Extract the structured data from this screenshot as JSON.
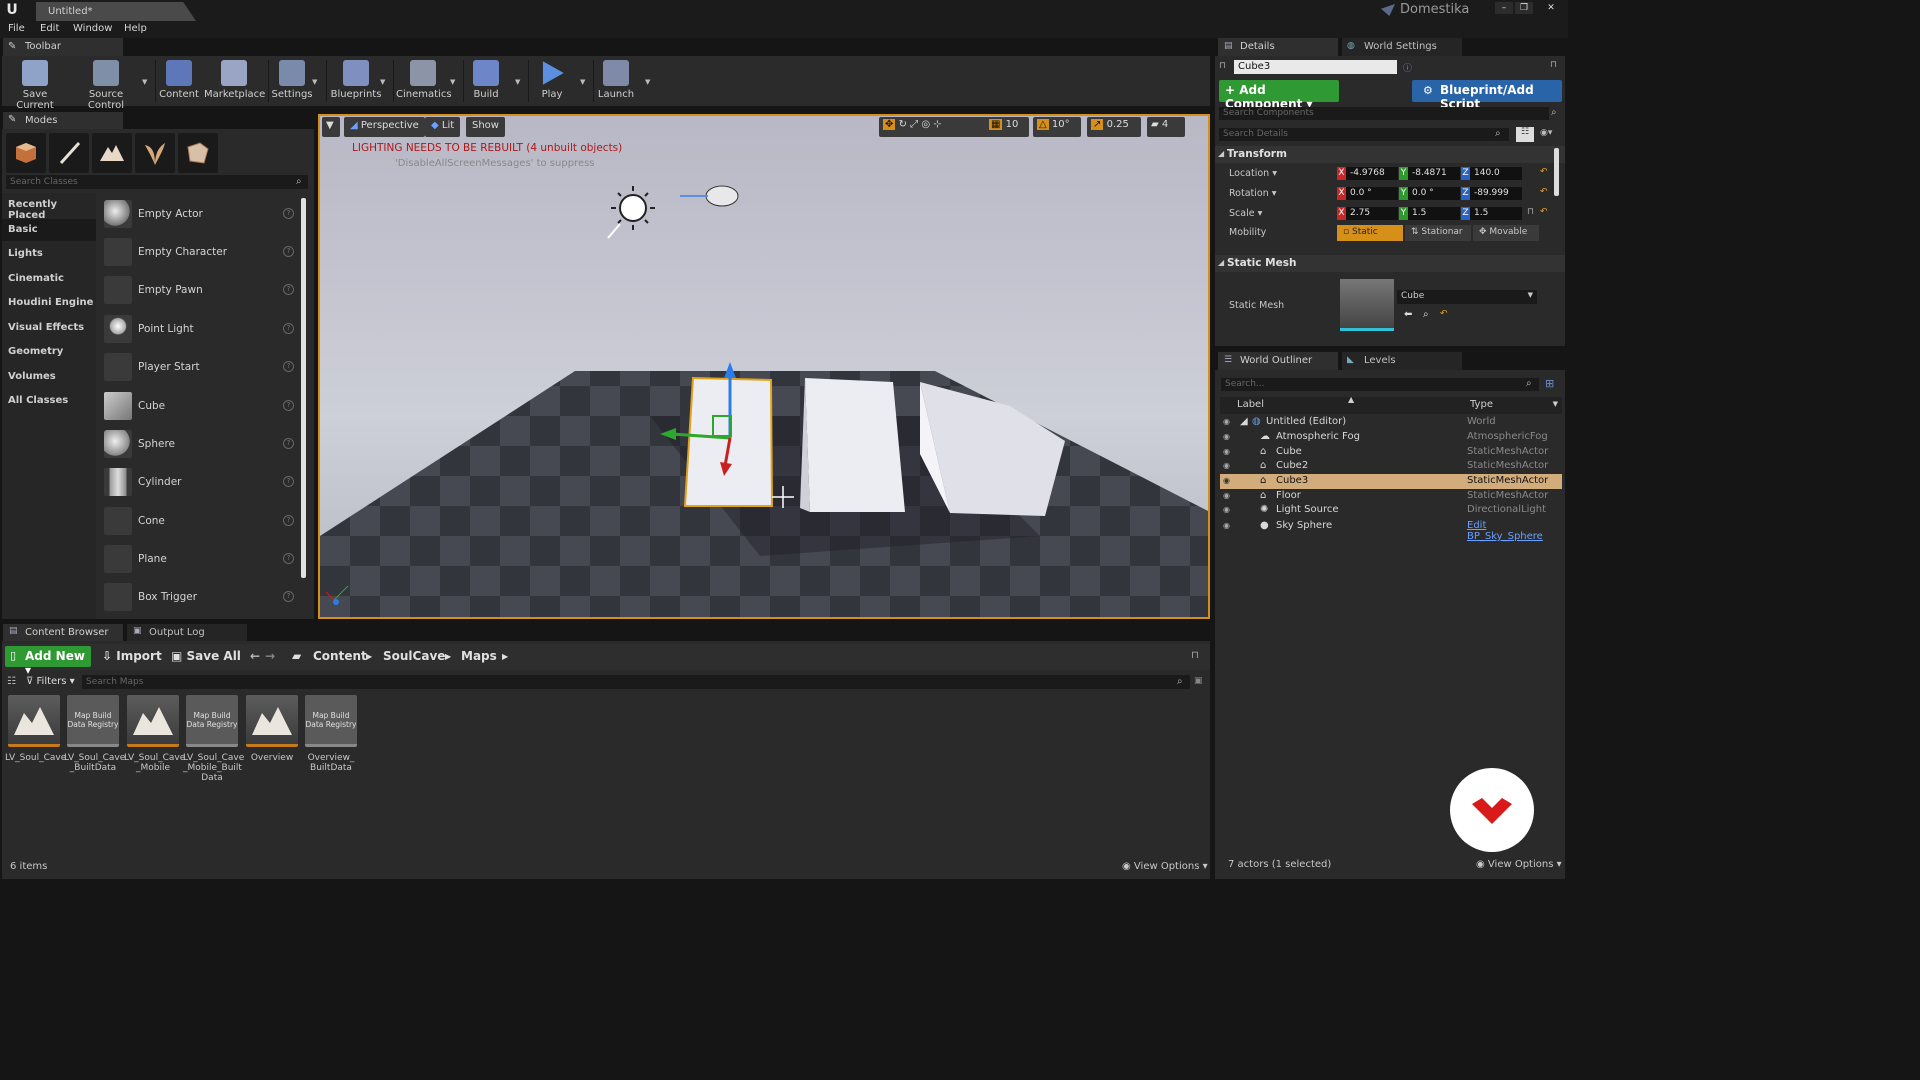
{
  "window": {
    "title": "Untitled*",
    "brand": "Domestika",
    "controls": [
      "–",
      "❐",
      "✕"
    ]
  },
  "menu": [
    "File",
    "Edit",
    "Window",
    "Help"
  ],
  "toolbar": {
    "tab": "Toolbar",
    "buttons": [
      {
        "label": "Save Current",
        "color": "#8fa3c8"
      },
      {
        "label": "Source Control",
        "color": "#7f8fa8"
      },
      {
        "label": "Content",
        "color": "#5d77b8"
      },
      {
        "label": "Marketplace",
        "color": "#9aa4c4"
      },
      {
        "label": "Settings",
        "color": "#7a8aaa"
      },
      {
        "label": "Blueprints",
        "color": "#7f90c0"
      },
      {
        "label": "Cinematics",
        "color": "#8c95a8"
      },
      {
        "label": "Build",
        "color": "#6d86c8"
      },
      {
        "label": "Play",
        "color": "#5d8fe0"
      },
      {
        "label": "Launch",
        "color": "#7e8aa8"
      }
    ]
  },
  "modes": {
    "tab": "Modes",
    "mode_icons": [
      "place-mode-icon",
      "paint-mode-icon",
      "landscape-mode-icon",
      "foliage-mode-icon",
      "geometry-mode-icon"
    ],
    "search_placeholder": "Search Classes",
    "categories": [
      "Recently Placed",
      "Basic",
      "Lights",
      "Cinematic",
      "Houdini Engine",
      "Visual Effects",
      "Geometry",
      "Volumes",
      "All Classes"
    ],
    "selected_category": "Basic",
    "items": [
      "Empty Actor",
      "Empty Character",
      "Empty Pawn",
      "Point Light",
      "Player Start",
      "Cube",
      "Sphere",
      "Cylinder",
      "Cone",
      "Plane",
      "Box Trigger"
    ]
  },
  "viewport": {
    "view_mode": "Perspective",
    "lighting": "Lit",
    "show": "Show",
    "grid_snap": "10",
    "rotation_snap": "10°",
    "scale_snap": "0.25",
    "camera_speed": "4",
    "warning": "LIGHTING NEEDS TO BE REBUILT (4 unbuilt objects)",
    "warning_hint": "'DisableAllScreenMessages' to suppress",
    "selection_color": "#d6901a"
  },
  "content_browser": {
    "tabs": [
      "Content Browser",
      "Output Log"
    ],
    "add_new": "Add New",
    "import": "Import",
    "save_all": "Save All",
    "path": [
      "Content",
      "SoulCave",
      "Maps"
    ],
    "filters": "Filters",
    "search_placeholder": "Search Maps",
    "assets": [
      {
        "name": "LV_Soul_Cave",
        "kind": "map"
      },
      {
        "name": "LV_Soul_Cave _BuiltData",
        "kind": "registry",
        "thumb_text": "Map Build Data Registry"
      },
      {
        "name": "LV_Soul_Cave _Mobile",
        "kind": "map"
      },
      {
        "name": "LV_Soul_Cave _Mobile_Built Data",
        "kind": "registry",
        "thumb_text": "Map Build Data Registry"
      },
      {
        "name": "Overview",
        "kind": "map"
      },
      {
        "name": "Overview_ BuiltData",
        "kind": "registry",
        "thumb_text": "Map Build Data Registry"
      }
    ],
    "item_count": "6 items",
    "view_options": "View Options"
  },
  "details": {
    "tabs": [
      "Details",
      "World Settings"
    ],
    "object_name": "Cube3",
    "add_component": "+ Add Component",
    "blueprint_script": "Blueprint/Add Script",
    "search_components": "Search Components",
    "search_details": "Search Details",
    "transform": {
      "title": "Transform",
      "location": {
        "label": "Location",
        "x": "-4.9768",
        "y": "-8.4871",
        "z": "140.0"
      },
      "rotation": {
        "label": "Rotation",
        "x": "0.0 °",
        "y": "0.0 °",
        "z": "-89.999"
      },
      "scale": {
        "label": "Scale",
        "x": "2.75",
        "y": "1.5",
        "z": "1.5"
      },
      "mobility": {
        "label": "Mobility",
        "options": [
          "Static",
          "Stationar",
          "Movable"
        ],
        "selected": "Static"
      }
    },
    "static_mesh": {
      "title": "Static Mesh",
      "label": "Static Mesh",
      "value": "Cube"
    }
  },
  "outliner": {
    "tabs": [
      "World Outliner",
      "Levels"
    ],
    "search_placeholder": "Search...",
    "columns": [
      "Label",
      "Type"
    ],
    "rows": [
      {
        "label": "Untitled (Editor)",
        "type": "World",
        "indent": 0
      },
      {
        "label": "Atmospheric Fog",
        "type": "AtmosphericFog",
        "indent": 1
      },
      {
        "label": "Cube",
        "type": "StaticMeshActor",
        "indent": 1
      },
      {
        "label": "Cube2",
        "type": "StaticMeshActor",
        "indent": 1
      },
      {
        "label": "Cube3",
        "type": "StaticMeshActor",
        "indent": 1,
        "selected": true
      },
      {
        "label": "Floor",
        "type": "StaticMeshActor",
        "indent": 1
      },
      {
        "label": "Light Source",
        "type": "DirectionalLight",
        "indent": 1
      },
      {
        "label": "Sky Sphere",
        "type": "Edit BP_Sky_Sphere",
        "indent": 1,
        "link": true
      }
    ],
    "status": "7 actors (1 selected)",
    "view_options": "View Options"
  },
  "colors": {
    "accent_green": "#2f9a33",
    "accent_blue": "#2a64a8",
    "selection": "#d3ac7c",
    "logo_red": "#d81a1a"
  }
}
